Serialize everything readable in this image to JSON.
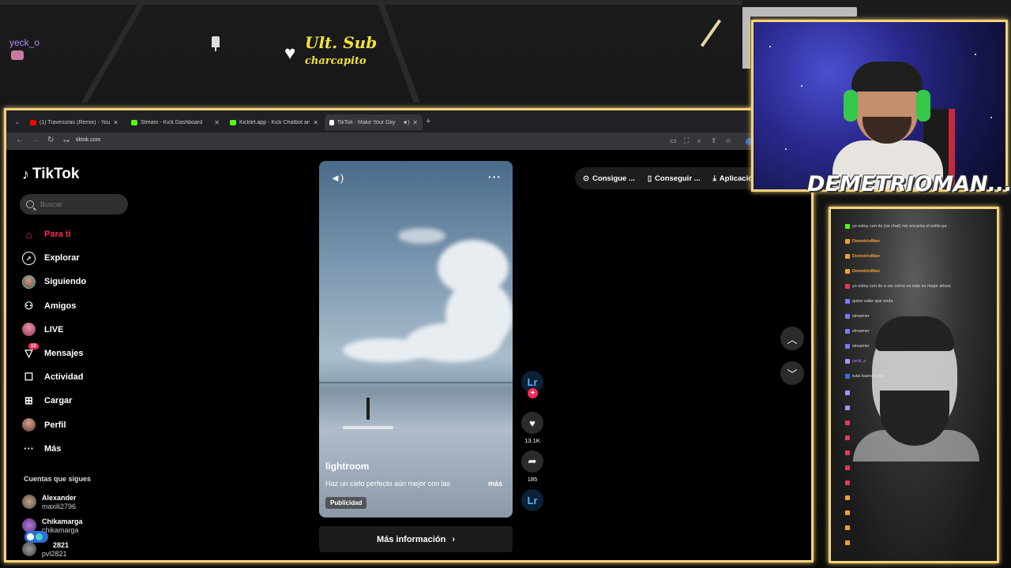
{
  "overlay": {
    "chat_user": "yeck_o",
    "ult_sub_title": "Ult. Sub",
    "ult_sub_name": "charcapito",
    "streamer_name": "DEMETRIOMAN..."
  },
  "browser": {
    "tabs": [
      {
        "label": "(1) Travesuras (Remix) - YouTube",
        "color": "#ff0000"
      },
      {
        "label": "Stream - Kick Dashboard",
        "color": "#53fc18"
      },
      {
        "label": "Kicklet.app - Kick Chatbot and",
        "color": "#53fc18"
      },
      {
        "label": "TikTok - Make Your Day",
        "color": "#ffffff"
      }
    ],
    "url": "tiktok.com"
  },
  "tiktok": {
    "logo": "TikTok",
    "search_placeholder": "Buscar",
    "menu": [
      {
        "label": "Para ti",
        "icon": "home-icon"
      },
      {
        "label": "Explorar",
        "icon": "compass-icon"
      },
      {
        "label": "Siguiendo",
        "icon": "following-avatar-icon"
      },
      {
        "label": "Amigos",
        "icon": "friends-icon"
      },
      {
        "label": "LIVE",
        "icon": "live-avatar-icon"
      },
      {
        "label": "Mensajes",
        "icon": "messages-icon",
        "badge": "12"
      },
      {
        "label": "Actividad",
        "icon": "activity-icon"
      },
      {
        "label": "Cargar",
        "icon": "upload-icon"
      },
      {
        "label": "Perfil",
        "icon": "profile-avatar-icon"
      },
      {
        "label": "Más",
        "icon": "more-icon"
      }
    ],
    "following_title": "Cuentas que sigues",
    "following": [
      {
        "name": "Alexander",
        "handle": "maxili2796"
      },
      {
        "name": "Chikamarga",
        "handle": "chikamarga"
      },
      {
        "name": "2821",
        "handle": "pvl2821"
      }
    ],
    "video": {
      "author": "lightroom",
      "caption": "Haz un cielo perfecto aún mejor con las",
      "more": "más",
      "ad_label": "Publicidad",
      "cta": "Más información"
    },
    "actions": {
      "lr_label": "Lr",
      "likes": "13.1K",
      "shares": "185"
    },
    "top_actions": [
      "Consigue ...",
      "Conseguir ...",
      "Aplicación"
    ]
  },
  "chat": {
    "messages": [
      "yo estoy con ds (un chat) me encanta el estilo pa",
      "DemetrioMan",
      "DemetrioMan",
      "DemetrioMan",
      "yo estoy con ds a ver como va esto es mejor ahora",
      "quien sabe que onda",
      "streamer",
      "streamer",
      "streamer",
      "yeck_o",
      "tuka buena sabe"
    ]
  }
}
